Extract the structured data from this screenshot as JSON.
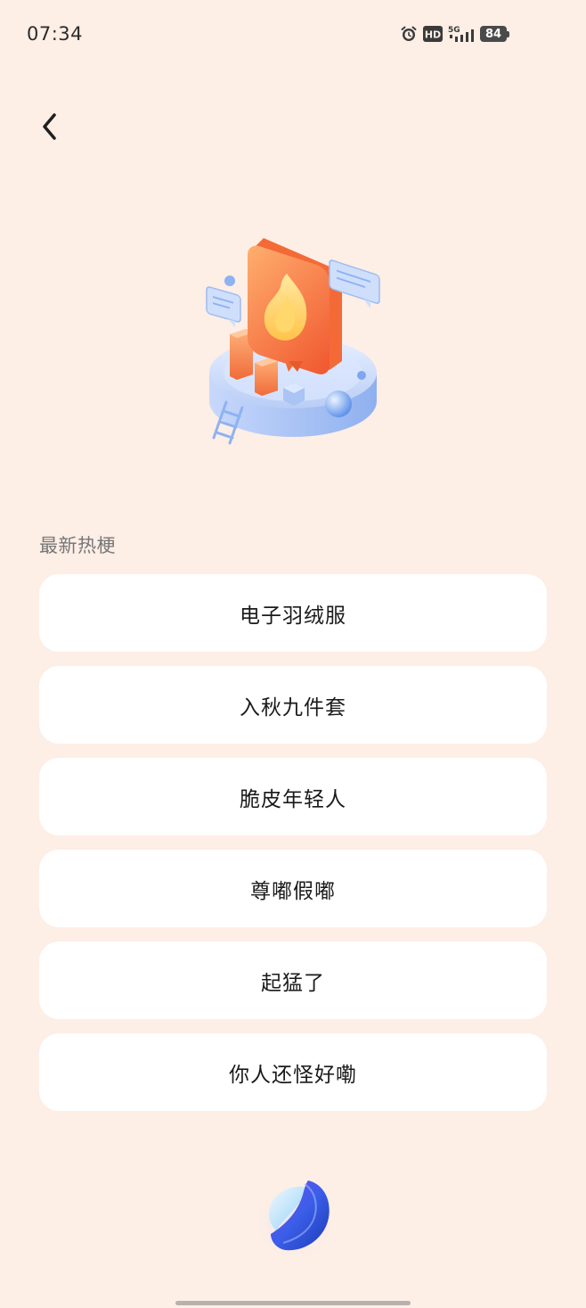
{
  "status_bar": {
    "time": "07:34",
    "network_label": "5G",
    "hd_label": "HD",
    "battery": "84",
    "icons": [
      "alarm-icon",
      "hd-icon",
      "signal-icon",
      "battery-icon"
    ]
  },
  "header": {
    "back_icon": "chevron-left-icon"
  },
  "illustration": {
    "name": "hot-topics-illustration"
  },
  "section": {
    "title": "最新热梗"
  },
  "topics": [
    {
      "label": "电子羽绒服"
    },
    {
      "label": "入秋九件套"
    },
    {
      "label": "脆皮年轻人"
    },
    {
      "label": "尊嘟假嘟"
    },
    {
      "label": "起猛了"
    },
    {
      "label": "你人还怪好嘞"
    }
  ],
  "colors": {
    "background": "#fdeee6",
    "card": "#ffffff",
    "accent_orange": "#f27a3c",
    "accent_blue": "#4a63e8"
  }
}
